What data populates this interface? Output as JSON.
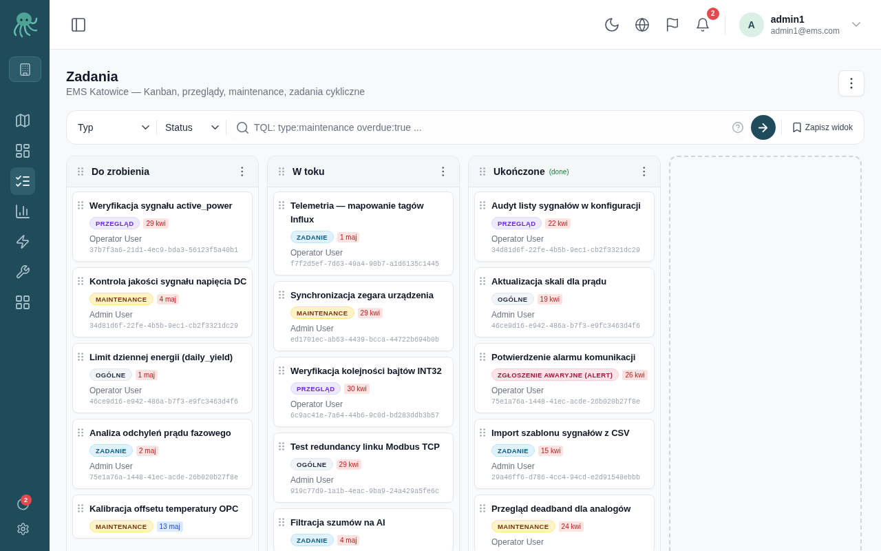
{
  "sidebar": {
    "nav": [
      {
        "selected": false
      },
      {
        "selected": false
      },
      {
        "selected": true
      },
      {
        "selected": false
      },
      {
        "selected": false
      },
      {
        "selected": false
      },
      {
        "selected": false
      }
    ],
    "alerts_badge": "2"
  },
  "header": {
    "notifications_badge": "2",
    "user": {
      "initial": "A",
      "name": "admin1",
      "email": "admin1@ems.com"
    }
  },
  "page": {
    "title": "Zadania",
    "subtitle": "EMS Katowice — Kanban, przeglądy, maintenance, zadania cykliczne"
  },
  "filter_bar": {
    "selects": [
      "Typ",
      "Status"
    ],
    "search": {
      "placeholder": "TQL: type:maintenance overdue:true ..."
    },
    "save_view": "Zapisz widok"
  },
  "board": {
    "columns": [
      {
        "title": "Do zrobienia",
        "cards": [
          {
            "title": "Weryfikacja sygnału active_power",
            "tag": {
              "label": "PRZEGLĄD",
              "kind": "review"
            },
            "due": {
              "label": "29 kwi",
              "overdue": true
            },
            "assignee": "Operator User",
            "id": "37b7f3a6-21d1-4ec9-bda3-56123f5a40b1"
          },
          {
            "title": "Kontrola jakości sygnału napięcia DC",
            "tag": {
              "label": "MAINTENANCE",
              "kind": "maintenance"
            },
            "due": {
              "label": "4 maj",
              "overdue": true
            },
            "assignee": "Admin User",
            "id": "34d81d6f-22fe-4b5b-9ec1-cb2f3321dc29"
          },
          {
            "title": "Limit dziennej energii (daily_yield)",
            "tag": {
              "label": "OGÓLNE",
              "kind": "general"
            },
            "due": {
              "label": "1 maj",
              "overdue": true
            },
            "assignee": "Operator User",
            "id": "46ce9d16-e942-486a-b7f3-e9fc3463d4f6"
          },
          {
            "title": "Analiza odchyleń prądu fazowego",
            "tag": {
              "label": "ZADANIE",
              "kind": "task"
            },
            "due": {
              "label": "2 maj",
              "overdue": true
            },
            "assignee": "Admin User",
            "id": "75e1a76a-1448-41ec-acde-26b020b27f8e"
          },
          {
            "title": "Kalibracja offsetu temperatury OPC",
            "tag": {
              "label": "MAINTENANCE",
              "kind": "maintenance"
            },
            "due": {
              "label": "13 maj",
              "overdue": false
            }
          }
        ]
      },
      {
        "title": "W toku",
        "cards": [
          {
            "title": "Telemetria — mapowanie tagów Influx",
            "tag": {
              "label": "ZADANIE",
              "kind": "task"
            },
            "due": {
              "label": "1 maj",
              "overdue": true
            },
            "assignee": "Operator User",
            "id": "f7f2d5ef-7d63-49a4-90b7-a1d6135c1445"
          },
          {
            "title": "Synchronizacja zegara urządzenia",
            "tag": {
              "label": "MAINTENANCE",
              "kind": "maintenance"
            },
            "due": {
              "label": "29 kwi",
              "overdue": true
            },
            "assignee": "Admin User",
            "id": "ed1701ec-ab63-4439-bcca-44722b694b0b"
          },
          {
            "title": "Weryfikacja kolejności bajtów INT32",
            "tag": {
              "label": "PRZEGLĄD",
              "kind": "review"
            },
            "due": {
              "label": "30 kwi",
              "overdue": true
            },
            "assignee": "Operator User",
            "id": "6c9ac41e-7a64-44b6-9c0d-bd283ddb3b57"
          },
          {
            "title": "Test redundancy linku Modbus TCP",
            "tag": {
              "label": "OGÓLNE",
              "kind": "general"
            },
            "due": {
              "label": "29 kwi",
              "overdue": true
            },
            "assignee": "Admin User",
            "id": "919c77d9-1a1b-4eac-9ba9-24a429a5fe6c"
          },
          {
            "title": "Filtracja szumów na AI",
            "tag": {
              "label": "ZADANIE",
              "kind": "task"
            },
            "due": {
              "label": "4 maj",
              "overdue": true
            }
          }
        ]
      },
      {
        "title": "Ukończone",
        "note": "(done)",
        "cards": [
          {
            "title": "Audyt listy sygnałów w konfiguracji",
            "tag": {
              "label": "PRZEGLĄD",
              "kind": "review"
            },
            "due": {
              "label": "22 kwi",
              "overdue": true
            },
            "assignee": "Operator User",
            "id": "34d81d6f-22fe-4b5b-9ec1-cb2f3321dc29"
          },
          {
            "title": "Aktualizacja skali dla prądu",
            "tag": {
              "label": "OGÓLNE",
              "kind": "general"
            },
            "due": {
              "label": "19 kwi",
              "overdue": true
            },
            "assignee": "Admin User",
            "id": "46ce9d16-e942-486a-b7f3-e9fc3463d4f6"
          },
          {
            "title": "Potwierdzenie alarmu komunikacji",
            "tag": {
              "label": "ZGŁOSZENIE AWARYJNE (ALERT)",
              "kind": "alert"
            },
            "due": {
              "label": "26 kwi",
              "overdue": true
            },
            "assignee": "Operator User",
            "id": "75e1a76a-1448-41ec-acde-26b020b27f8e"
          },
          {
            "title": "Import szablonu sygnałów z CSV",
            "tag": {
              "label": "ZADANIE",
              "kind": "task"
            },
            "due": {
              "label": "15 kwi",
              "overdue": true
            },
            "assignee": "Admin User",
            "id": "29a46ff6-d786-4cc4-94cd-e2d91548ebbb"
          },
          {
            "title": "Przegląd deadband dla analogów",
            "tag": {
              "label": "MAINTENANCE",
              "kind": "maintenance"
            },
            "due": {
              "label": "24 kwi",
              "overdue": true
            },
            "assignee": "Operator User"
          }
        ]
      }
    ]
  }
}
